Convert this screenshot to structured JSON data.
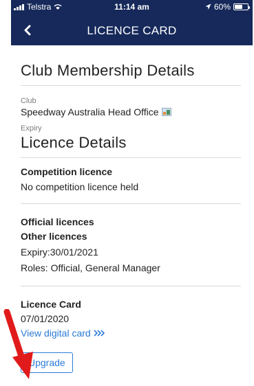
{
  "status_bar": {
    "carrier": "Telstra",
    "time": "11:14 am",
    "battery": "60%",
    "battery_level": 0.6
  },
  "nav": {
    "back_icon": "chevron-left-icon",
    "title": "LICENCE CARD"
  },
  "club_section": {
    "heading": "Club Membership Details",
    "club_label": "Club",
    "club_value": "Speedway Australia Head Office",
    "expiry_label": "Expiry"
  },
  "licence_section": {
    "heading": "Licence Details",
    "competition_title": "Competition licence",
    "competition_value": "No competition licence held",
    "official_title": "Official licences",
    "other_title": "Other licences",
    "other_expiry": "Expiry:30/01/2021",
    "other_roles": "Roles: Official, General Manager",
    "card_title": "Licence Card",
    "card_date": "07/01/2020",
    "view_link": "View digital card",
    "upgrade_button": "Upgrade"
  },
  "colors": {
    "header_bg": "#16295a",
    "accent": "#2b7bd6",
    "annotation_arrow": "#e11b1b"
  }
}
